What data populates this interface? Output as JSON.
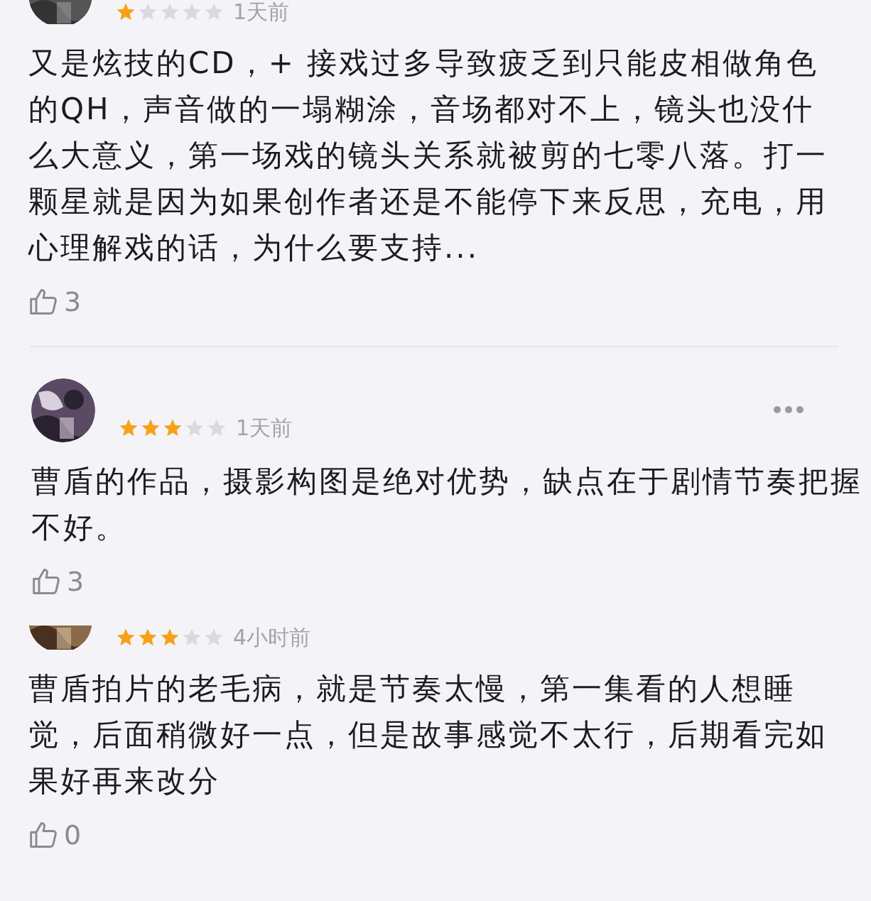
{
  "reviews": [
    {
      "kind": "clipped",
      "stars": 1,
      "time": "1天前",
      "more_menu": false,
      "text": "又是炫技的CD，+ 接戏过多导致疲乏到只能皮相做角色的QH，声音做的一塌糊涂，音场都对不上，镜头也没什么大意义，第一场戏的镜头关系就被剪的七零八落。打一颗星就是因为如果创作者还是不能停下来反思，充电，用心理解戏的话，为什么要支持...",
      "likes": "3"
    },
    {
      "kind": "full",
      "stars": 3,
      "time": "1天前",
      "more_menu": true,
      "text": "曹盾的作品，摄影构图是绝对优势，缺点在于剧情节奏把握不好。",
      "likes": "3"
    },
    {
      "kind": "clipped",
      "stars": 3,
      "time": "4小时前",
      "more_menu": false,
      "text": "曹盾拍片的老毛病，就是节奏太慢，第一集看的人想睡觉，后面稍微好一点，但是故事感觉不太行，后期看完如果好再来改分",
      "likes": "0"
    }
  ]
}
